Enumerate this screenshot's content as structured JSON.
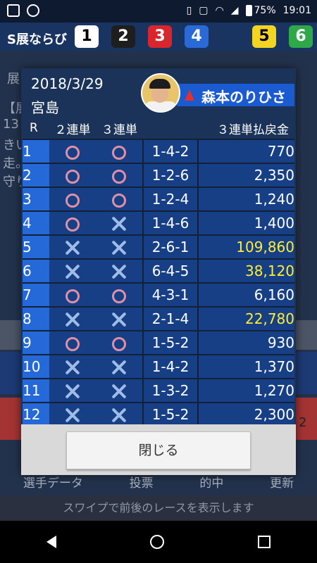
{
  "status_bar": {
    "battery": "75%",
    "time": "19:01"
  },
  "background": {
    "s_label": "S展ならび",
    "boats": [
      "1",
      "2",
      "3",
      "4",
      "5",
      "6"
    ],
    "tenkai_label": "展",
    "text_lines": [
      "【展",
      "13",
      "きい",
      "走。",
      "守り"
    ],
    "bottom_nav": [
      "選手データ",
      "投票",
      "的中",
      "更新"
    ],
    "swipe_hint": "スワイプで前後のレースを表示します",
    "right_number": "2"
  },
  "dialog": {
    "date": "2018/3/29",
    "venue": "宮島",
    "tipster_name": "森本のりひさ",
    "columns": [
      "R",
      "２連単",
      "３連単",
      "",
      "３連単払戻金"
    ],
    "races": [
      {
        "r": "1",
        "nirentan": "circle",
        "sanrentan": "circle",
        "combo": "1-4-2",
        "payout": "770",
        "high": false
      },
      {
        "r": "2",
        "nirentan": "circle",
        "sanrentan": "circle",
        "combo": "1-2-6",
        "payout": "2,350",
        "high": false
      },
      {
        "r": "3",
        "nirentan": "circle",
        "sanrentan": "circle",
        "combo": "1-2-4",
        "payout": "1,240",
        "high": false
      },
      {
        "r": "4",
        "nirentan": "circle",
        "sanrentan": "cross",
        "combo": "1-4-6",
        "payout": "1,400",
        "high": false
      },
      {
        "r": "5",
        "nirentan": "cross",
        "sanrentan": "cross",
        "combo": "2-6-1",
        "payout": "109,860",
        "high": true
      },
      {
        "r": "6",
        "nirentan": "cross",
        "sanrentan": "cross",
        "combo": "6-4-5",
        "payout": "38,120",
        "high": true
      },
      {
        "r": "7",
        "nirentan": "circle",
        "sanrentan": "circle",
        "combo": "4-3-1",
        "payout": "6,160",
        "high": false
      },
      {
        "r": "8",
        "nirentan": "cross",
        "sanrentan": "cross",
        "combo": "2-1-4",
        "payout": "22,780",
        "high": true
      },
      {
        "r": "9",
        "nirentan": "circle",
        "sanrentan": "circle",
        "combo": "1-5-2",
        "payout": "930",
        "high": false
      },
      {
        "r": "10",
        "nirentan": "cross",
        "sanrentan": "cross",
        "combo": "1-4-2",
        "payout": "1,370",
        "high": false
      },
      {
        "r": "11",
        "nirentan": "cross",
        "sanrentan": "cross",
        "combo": "1-3-2",
        "payout": "1,270",
        "high": false
      },
      {
        "r": "12",
        "nirentan": "cross",
        "sanrentan": "cross",
        "combo": "1-5-2",
        "payout": "2,300",
        "high": false
      }
    ],
    "close_label": "閉じる"
  },
  "colors": {
    "boat_colors": [
      "#ffffff",
      "#1e1e1e",
      "#d8262c",
      "#2a6ad6",
      "#f3d521",
      "#2fa84a"
    ],
    "boat_text": [
      "#000000",
      "#ffffff",
      "#ffffff",
      "#ffffff",
      "#000000",
      "#ffffff"
    ],
    "hit_circle": "#e18fa4",
    "miss_cross": "#9fbce8",
    "high_payout": "#ffee33"
  }
}
